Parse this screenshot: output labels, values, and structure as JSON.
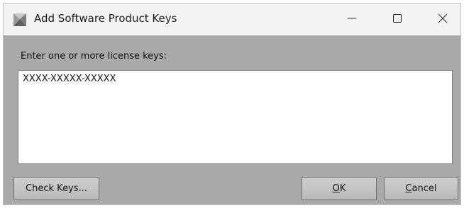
{
  "window": {
    "title": "Add Software Product Keys",
    "controls": {
      "minimize_icon": "minimize-icon",
      "maximize_icon": "maximize-icon",
      "close_icon": "close-icon"
    }
  },
  "dialog": {
    "prompt": "Enter one or more license keys:",
    "keys_value": "XXXX-XXXXX-XXXXX"
  },
  "buttons": {
    "check_keys": "Check Keys...",
    "ok_mnemonic": "O",
    "ok_rest": "K",
    "cancel_mnemonic": "C",
    "cancel_rest": "ancel"
  },
  "colors": {
    "titlebar": "#f3f3f3",
    "client": "#a9a9a9",
    "button": "#c4c4c4"
  }
}
